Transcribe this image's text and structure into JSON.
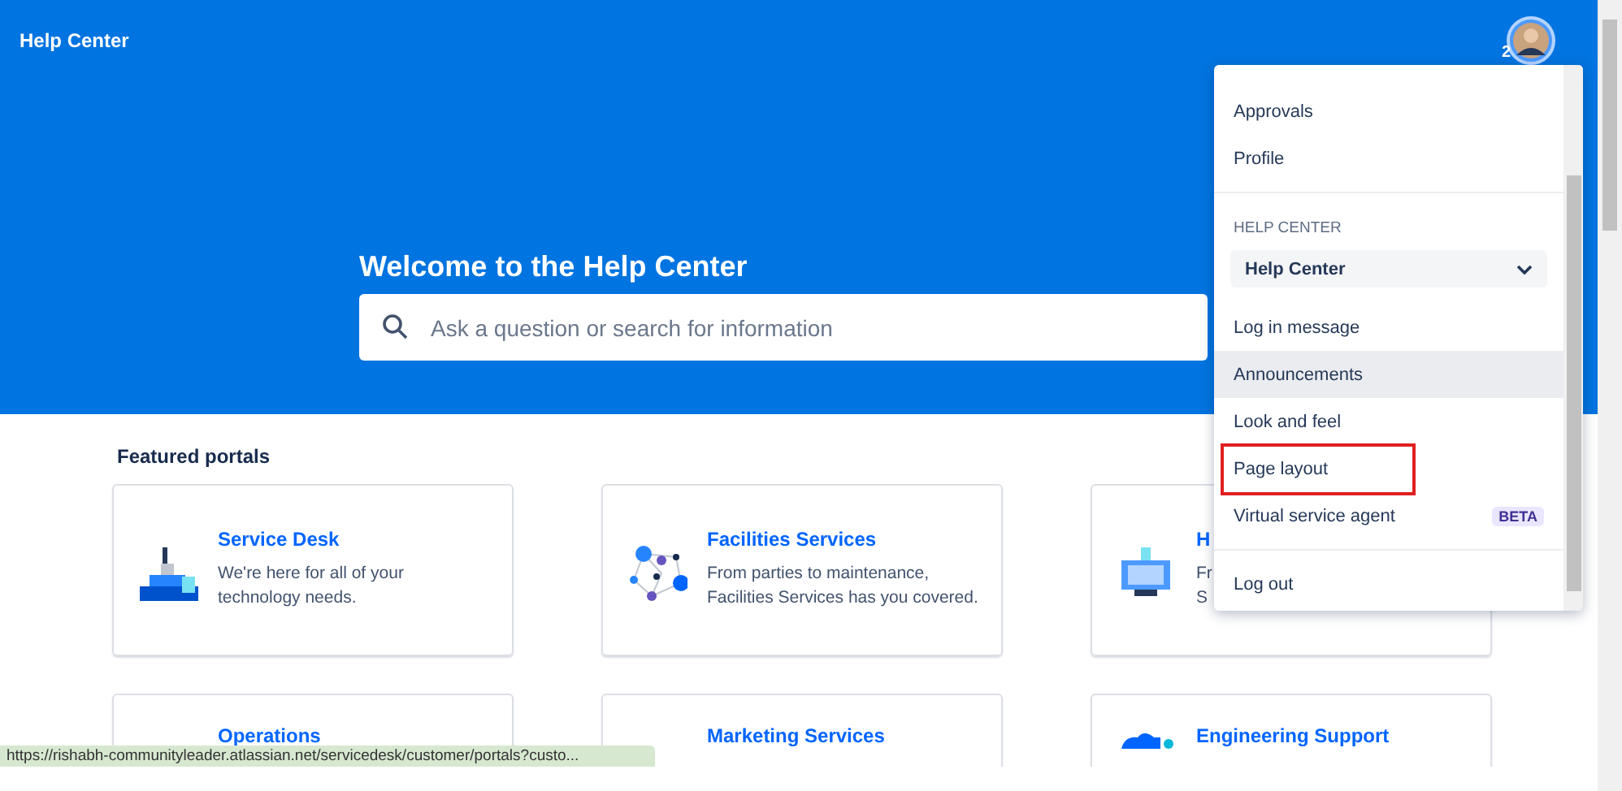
{
  "header": {
    "title": "Help Center",
    "notification_count": "2"
  },
  "hero": {
    "title": "Welcome to the Help Center",
    "search": {
      "placeholder": "Ask a question or search for information"
    }
  },
  "featured": {
    "heading": "Featured portals",
    "portals": [
      {
        "title": "Service Desk",
        "description": [
          "We're here for all of your",
          "technology needs."
        ]
      },
      {
        "title": "Facilities Services",
        "description": [
          "From parties to maintenance,",
          "Facilities Services has you covered."
        ]
      },
      {
        "title": "H",
        "description": [
          "Fr",
          "S"
        ]
      },
      {
        "title": "Operations"
      },
      {
        "title": "Marketing Services"
      },
      {
        "title": "Engineering Support"
      }
    ]
  },
  "menu": {
    "items": [
      {
        "kind": "item",
        "label": "Approvals",
        "hovered": false,
        "annotated": false
      },
      {
        "kind": "item",
        "label": "Profile",
        "hovered": false,
        "annotated": false
      },
      {
        "kind": "divider"
      },
      {
        "kind": "heading",
        "label": "HELP CENTER"
      },
      {
        "kind": "select",
        "label": "Help Center"
      },
      {
        "kind": "item",
        "label": "Log in message",
        "hovered": false,
        "annotated": false
      },
      {
        "kind": "item",
        "label": "Announcements",
        "hovered": true,
        "annotated": false
      },
      {
        "kind": "item",
        "label": "Look and feel",
        "hovered": false,
        "annotated": false
      },
      {
        "kind": "item",
        "label": "Page layout",
        "hovered": false,
        "annotated": true
      },
      {
        "kind": "item",
        "label": "Virtual service agent",
        "badge": "BETA",
        "hovered": false,
        "annotated": false
      },
      {
        "kind": "divider"
      },
      {
        "kind": "item",
        "label": "Log out",
        "hovered": false,
        "annotated": false
      }
    ]
  },
  "status_bar": {
    "url": "https://rishabh-communityleader.atlassian.net/servicedesk/customer/portals?custo..."
  }
}
